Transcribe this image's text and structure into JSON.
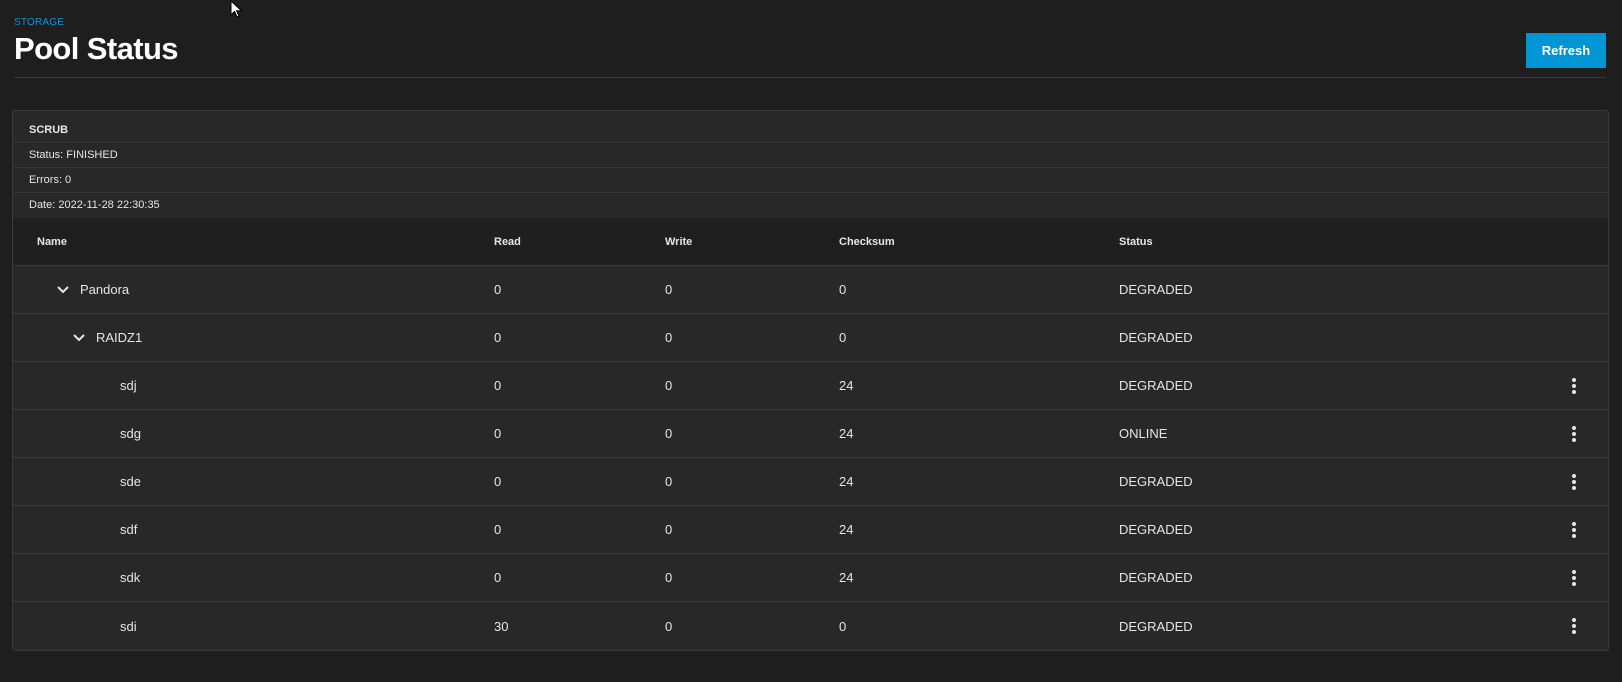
{
  "header": {
    "breadcrumb": "STORAGE",
    "title": "Pool Status",
    "refresh_label": "Refresh"
  },
  "scrub": {
    "title": "SCRUB",
    "status": "Status: FINISHED",
    "errors": "Errors: 0",
    "date": "Date: 2022-11-28 22:30:35"
  },
  "table": {
    "columns": {
      "name": "Name",
      "read": "Read",
      "write": "Write",
      "checksum": "Checksum",
      "status": "Status"
    },
    "rows": [
      {
        "name": "Pandora",
        "read": "0",
        "write": "0",
        "checksum": "0",
        "status": "DEGRADED",
        "expandable": true
      },
      {
        "name": "RAIDZ1",
        "read": "0",
        "write": "0",
        "checksum": "0",
        "status": "DEGRADED",
        "expandable": true
      },
      {
        "name": "sdj",
        "read": "0",
        "write": "0",
        "checksum": "24",
        "status": "DEGRADED"
      },
      {
        "name": "sdg",
        "read": "0",
        "write": "0",
        "checksum": "24",
        "status": "ONLINE"
      },
      {
        "name": "sde",
        "read": "0",
        "write": "0",
        "checksum": "24",
        "status": "DEGRADED"
      },
      {
        "name": "sdf",
        "read": "0",
        "write": "0",
        "checksum": "24",
        "status": "DEGRADED"
      },
      {
        "name": "sdk",
        "read": "0",
        "write": "0",
        "checksum": "24",
        "status": "DEGRADED"
      },
      {
        "name": "sdi",
        "read": "30",
        "write": "0",
        "checksum": "0",
        "status": "DEGRADED"
      }
    ]
  },
  "icons": {
    "expand": "chevron-down-icon",
    "actions": "more-vert-icon",
    "cursor": "mouse-cursor-icon"
  },
  "colors": {
    "accent": "#0095d5",
    "background": "#1e1e1e",
    "card": "#282828"
  }
}
